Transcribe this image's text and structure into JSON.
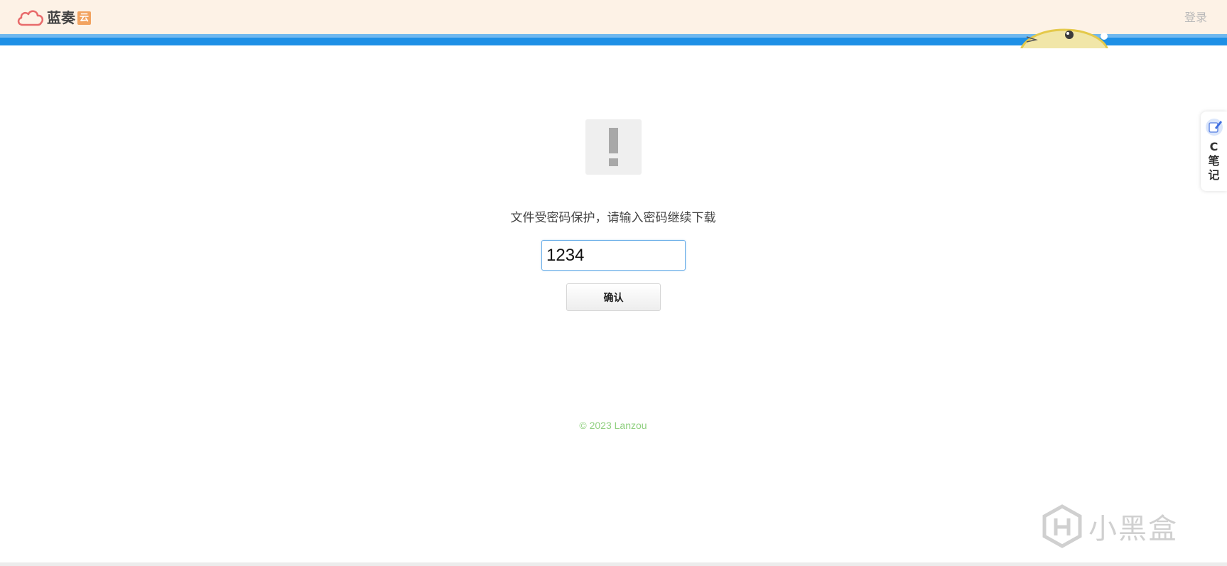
{
  "header": {
    "logo_text": "蓝奏",
    "logo_badge": "云",
    "login_label": "登录"
  },
  "main": {
    "prompt": "文件受密码保护，请输入密码继续下载",
    "password_value": "1234",
    "confirm_label": "确认"
  },
  "footer": {
    "copyright": "© 2023 Lanzou"
  },
  "side_widget": {
    "label_line1": "C",
    "label_line2": "笔",
    "label_line3": "记"
  },
  "watermark": {
    "text": "小黑盒"
  },
  "colors": {
    "header_bg": "#fdf2e6",
    "accent_blue": "#1e90e6",
    "logo_cloud": "#e86b6b",
    "logo_badge": "#f2a360",
    "copyright_green": "#8fcf7f"
  },
  "icons": {
    "logo": "cloud-icon",
    "warning": "exclamation-icon",
    "side_note": "note-icon",
    "watermark": "heybox-logo-icon"
  }
}
